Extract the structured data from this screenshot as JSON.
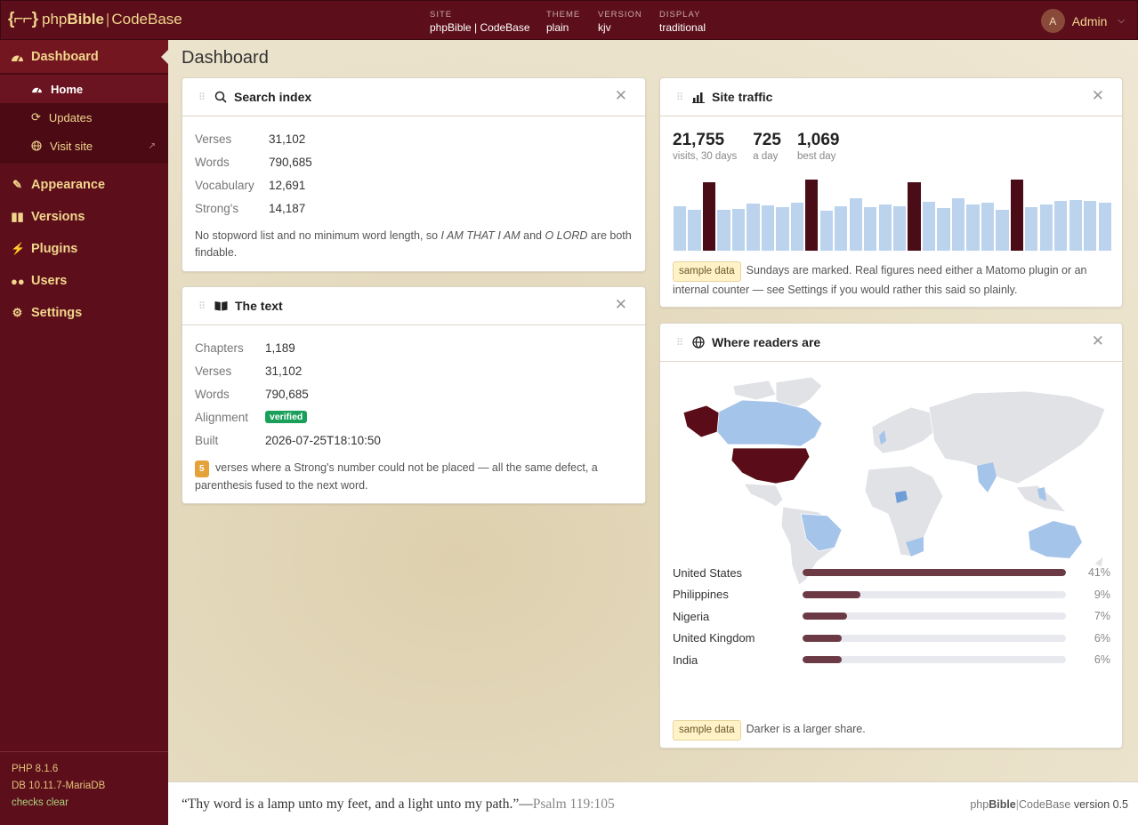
{
  "brand": {
    "brace": "{⌐⌐}",
    "php": "php",
    "bible": "Bible",
    "sep": "|",
    "codebase": "CodeBase"
  },
  "header": {
    "meta": [
      {
        "key": "SITE",
        "value": "phpBible | CodeBase"
      },
      {
        "key": "THEME",
        "value": "plain"
      },
      {
        "key": "VERSION",
        "value": "kjv"
      },
      {
        "key": "DISPLAY",
        "value": "traditional"
      }
    ],
    "user": {
      "initial": "A",
      "name": "Admin"
    }
  },
  "sidebar": {
    "dashboard": "Dashboard",
    "sub": [
      {
        "label": "Home",
        "icon": "gauge-icon"
      },
      {
        "label": "Updates",
        "icon": "refresh-icon"
      },
      {
        "label": "Visit site",
        "icon": "globe-icon"
      }
    ],
    "items": [
      {
        "label": "Appearance",
        "icon": "brush-icon"
      },
      {
        "label": "Versions",
        "icon": "book-open-icon"
      },
      {
        "label": "Plugins",
        "icon": "plug-icon"
      },
      {
        "label": "Users",
        "icon": "users-icon"
      },
      {
        "label": "Settings",
        "icon": "gear-icon"
      }
    ],
    "footer": {
      "php": "PHP 8.1.6",
      "db": "DB 10.11.7-MariaDB",
      "checks": "checks clear"
    }
  },
  "page_title": "Dashboard",
  "search_index": {
    "title": "Search index",
    "rows": [
      {
        "k": "Verses",
        "v": "31,102"
      },
      {
        "k": "Words",
        "v": "790,685"
      },
      {
        "k": "Vocabulary",
        "v": "12,691"
      },
      {
        "k": "Strong's",
        "v": "14,187"
      }
    ],
    "note_a": "No stopword list and no minimum word length, so ",
    "note_i1": "I AM THAT I AM",
    "note_b": " and ",
    "note_i2": "O LORD",
    "note_c": " are both findable."
  },
  "the_text": {
    "title": "The text",
    "rows": [
      {
        "k": "Chapters",
        "v": "1,189"
      },
      {
        "k": "Verses",
        "v": "31,102"
      },
      {
        "k": "Words",
        "v": "790,685"
      },
      {
        "k": "Alignment",
        "badge": "verified"
      },
      {
        "k": "Built",
        "v": "2026-07-25T18:10:50"
      }
    ],
    "note_count": "5",
    "note": " verses where a Strong's number could not be placed — all the same defect, a parenthesis fused to the next word."
  },
  "site_traffic": {
    "title": "Site traffic",
    "stats": [
      {
        "n": "21,755",
        "l": "visits, 30 days"
      },
      {
        "n": "725",
        "l": "a day"
      },
      {
        "n": "1,069",
        "l": "best day"
      }
    ],
    "tag": "sample data",
    "note": "Sundays are marked. Real figures need either a Matomo plugin or an internal counter — see Settings if you would rather this said so plainly.",
    "colors": {
      "day": "#bcd3ee",
      "sunday": "#4a0c16"
    },
    "days": [
      0.63,
      0.57,
      0.96,
      0.58,
      0.59,
      0.66,
      0.64,
      0.61,
      0.68,
      1.0,
      0.56,
      0.62,
      0.74,
      0.61,
      0.65,
      0.62,
      0.96,
      0.69,
      0.6,
      0.74,
      0.65,
      0.68,
      0.58,
      1.0,
      0.61,
      0.65,
      0.7,
      0.71,
      0.7,
      0.68
    ],
    "sundays": [
      2,
      9,
      16,
      23
    ]
  },
  "readers": {
    "title": "Where readers are",
    "countries": [
      {
        "name": "United States",
        "pct": "41%",
        "share": 1.0
      },
      {
        "name": "Philippines",
        "pct": "9%",
        "share": 0.22
      },
      {
        "name": "Nigeria",
        "pct": "7%",
        "share": 0.17
      },
      {
        "name": "United Kingdom",
        "pct": "6%",
        "share": 0.15
      },
      {
        "name": "India",
        "pct": "6%",
        "share": 0.15
      }
    ],
    "tag": "sample data",
    "note": "Darker is a larger share."
  },
  "footer": {
    "verse": "“Thy word is a lamp unto my feet, and a light unto my path.”—",
    "ref": "Psalm 119:105",
    "php": "php",
    "bible": "Bible",
    "sep": "|",
    "codebase": "CodeBase",
    "version": " version 0.5"
  }
}
